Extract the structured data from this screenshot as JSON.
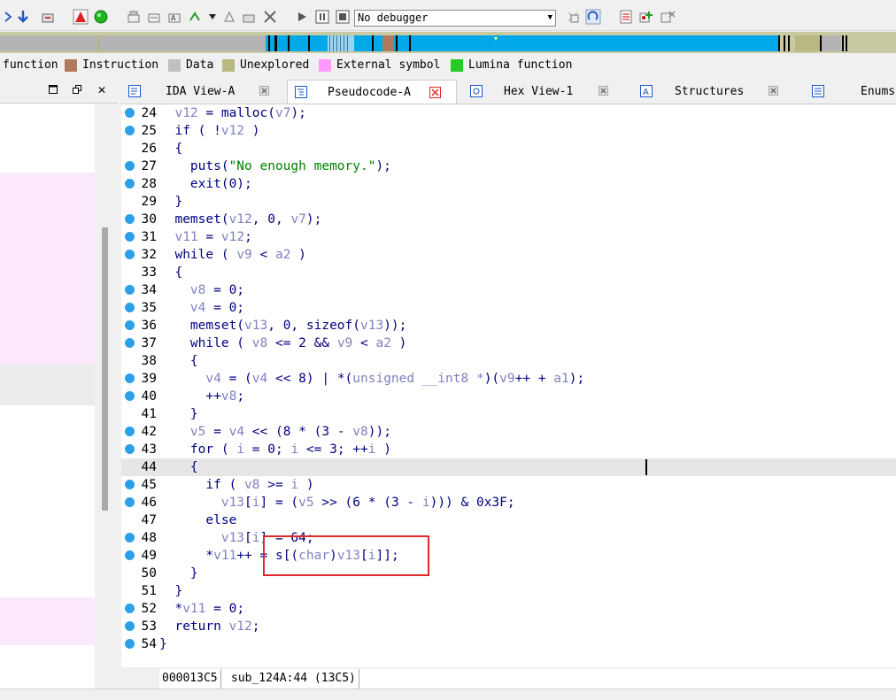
{
  "toolbar": {
    "debugger_select": "No debugger"
  },
  "legend": [
    {
      "label": "function",
      "color": "#00bbff"
    },
    {
      "label": "Instruction",
      "color": "#b07a5e"
    },
    {
      "label": "Data",
      "color": "#c0c0c0"
    },
    {
      "label": "Unexplored",
      "color": "#b8b880"
    },
    {
      "label": "External symbol",
      "color": "#ff99ff"
    },
    {
      "label": "Lumina function",
      "color": "#22cc22"
    }
  ],
  "tabs": [
    {
      "label": "IDA View-A",
      "icon": "ida-view-icon"
    },
    {
      "label": "Pseudocode-A",
      "icon": "pseudocode-icon"
    },
    {
      "label": "Hex View-1",
      "icon": "hex-view-icon"
    },
    {
      "label": "Structures",
      "icon": "structures-icon"
    },
    {
      "label": "Enums",
      "icon": "enums-icon"
    }
  ],
  "colors": {
    "dot": "#2ba0e8",
    "keyword": "#000080",
    "variable": "#8080c0",
    "string": "#008000",
    "highlight_box": "#e02a2a"
  },
  "code": [
    {
      "n": "24",
      "dot": true,
      "tokens": [
        [
          "  ",
          ""
        ],
        [
          "v12",
          "var"
        ],
        [
          " = malloc(",
          ""
        ],
        [
          "v7",
          "var"
        ],
        [
          ");",
          ""
        ]
      ]
    },
    {
      "n": "25",
      "dot": true,
      "tokens": [
        [
          "  if ( !",
          ""
        ],
        [
          "v12",
          "var"
        ],
        [
          " )",
          ""
        ]
      ]
    },
    {
      "n": "26",
      "dot": false,
      "tokens": [
        [
          "  {",
          ""
        ]
      ]
    },
    {
      "n": "27",
      "dot": true,
      "tokens": [
        [
          "    puts(",
          ""
        ],
        [
          "\"No enough memory.\"",
          "str"
        ],
        [
          ");",
          ""
        ]
      ]
    },
    {
      "n": "28",
      "dot": true,
      "tokens": [
        [
          "    exit(0);",
          ""
        ]
      ]
    },
    {
      "n": "29",
      "dot": false,
      "tokens": [
        [
          "  }",
          ""
        ]
      ]
    },
    {
      "n": "30",
      "dot": true,
      "tokens": [
        [
          "  memset(",
          ""
        ],
        [
          "v12",
          "var"
        ],
        [
          ", 0, ",
          ""
        ],
        [
          "v7",
          "var"
        ],
        [
          ");",
          ""
        ]
      ]
    },
    {
      "n": "31",
      "dot": true,
      "tokens": [
        [
          "  ",
          ""
        ],
        [
          "v11",
          "var"
        ],
        [
          " = ",
          ""
        ],
        [
          "v12",
          "var"
        ],
        [
          ";",
          ""
        ]
      ]
    },
    {
      "n": "32",
      "dot": true,
      "tokens": [
        [
          "  while ( ",
          ""
        ],
        [
          "v9",
          "var"
        ],
        [
          " < ",
          ""
        ],
        [
          "a2",
          "var"
        ],
        [
          " )",
          ""
        ]
      ]
    },
    {
      "n": "33",
      "dot": false,
      "tokens": [
        [
          "  {",
          ""
        ]
      ]
    },
    {
      "n": "34",
      "dot": true,
      "tokens": [
        [
          "    ",
          ""
        ],
        [
          "v8",
          "var"
        ],
        [
          " = 0;",
          ""
        ]
      ]
    },
    {
      "n": "35",
      "dot": true,
      "tokens": [
        [
          "    ",
          ""
        ],
        [
          "v4",
          "var"
        ],
        [
          " = 0;",
          ""
        ]
      ]
    },
    {
      "n": "36",
      "dot": true,
      "tokens": [
        [
          "    memset(",
          ""
        ],
        [
          "v13",
          "var"
        ],
        [
          ", 0, sizeof(",
          ""
        ],
        [
          "v13",
          "var"
        ],
        [
          "));",
          ""
        ]
      ]
    },
    {
      "n": "37",
      "dot": true,
      "tokens": [
        [
          "    while ( ",
          ""
        ],
        [
          "v8",
          "var"
        ],
        [
          " <= 2 && ",
          ""
        ],
        [
          "v9",
          "var"
        ],
        [
          " < ",
          ""
        ],
        [
          "a2",
          "var"
        ],
        [
          " )",
          ""
        ]
      ]
    },
    {
      "n": "38",
      "dot": false,
      "tokens": [
        [
          "    {",
          ""
        ]
      ]
    },
    {
      "n": "39",
      "dot": true,
      "tokens": [
        [
          "      ",
          ""
        ],
        [
          "v4",
          "var"
        ],
        [
          " = (",
          ""
        ],
        [
          "v4",
          "var"
        ],
        [
          " << 8) | *(",
          ""
        ],
        [
          "unsigned __int8 *",
          "var"
        ],
        [
          ")(",
          ""
        ],
        [
          "v9",
          "var"
        ],
        [
          "++ + ",
          ""
        ],
        [
          "a1",
          "var"
        ],
        [
          ");",
          ""
        ]
      ]
    },
    {
      "n": "40",
      "dot": true,
      "tokens": [
        [
          "      ++",
          ""
        ],
        [
          "v8",
          "var"
        ],
        [
          ";",
          ""
        ]
      ]
    },
    {
      "n": "41",
      "dot": false,
      "tokens": [
        [
          "    }",
          ""
        ]
      ]
    },
    {
      "n": "42",
      "dot": true,
      "tokens": [
        [
          "    ",
          ""
        ],
        [
          "v5",
          "var"
        ],
        [
          " = ",
          ""
        ],
        [
          "v4",
          "var"
        ],
        [
          " << (8 * (3 - ",
          ""
        ],
        [
          "v8",
          "var"
        ],
        [
          "));",
          ""
        ]
      ]
    },
    {
      "n": "43",
      "dot": true,
      "tokens": [
        [
          "    for ( ",
          ""
        ],
        [
          "i",
          "var"
        ],
        [
          " = 0; ",
          ""
        ],
        [
          "i",
          "var"
        ],
        [
          " <= 3; ++",
          ""
        ],
        [
          "i",
          "var"
        ],
        [
          " )",
          ""
        ]
      ]
    },
    {
      "n": "44",
      "dot": false,
      "tokens": [
        [
          "    {",
          ""
        ]
      ],
      "current": true
    },
    {
      "n": "45",
      "dot": true,
      "tokens": [
        [
          "      if ( ",
          ""
        ],
        [
          "v8",
          "var"
        ],
        [
          " >= ",
          ""
        ],
        [
          "i",
          "var"
        ],
        [
          " )",
          ""
        ]
      ]
    },
    {
      "n": "46",
      "dot": true,
      "tokens": [
        [
          "        ",
          ""
        ],
        [
          "v13",
          "var"
        ],
        [
          "[",
          ""
        ],
        [
          "i",
          "var"
        ],
        [
          "] = (",
          ""
        ],
        [
          "v5",
          "var"
        ],
        [
          " >> (6 * (3 - ",
          ""
        ],
        [
          "i",
          "var"
        ],
        [
          "))) & 0x3F;",
          ""
        ]
      ]
    },
    {
      "n": "47",
      "dot": false,
      "tokens": [
        [
          "      else",
          ""
        ]
      ]
    },
    {
      "n": "48",
      "dot": true,
      "tokens": [
        [
          "        ",
          ""
        ],
        [
          "v13",
          "var"
        ],
        [
          "[",
          ""
        ],
        [
          "i",
          "var"
        ],
        [
          "] = 64;",
          ""
        ]
      ]
    },
    {
      "n": "49",
      "dot": true,
      "tokens": [
        [
          "      *",
          ""
        ],
        [
          "v11",
          "var"
        ],
        [
          "++ = s[(",
          ""
        ],
        [
          "char",
          "var"
        ],
        [
          ")",
          ""
        ],
        [
          "v13",
          "var"
        ],
        [
          "[",
          ""
        ],
        [
          "i",
          "var"
        ],
        [
          "]];",
          ""
        ]
      ]
    },
    {
      "n": "50",
      "dot": false,
      "tokens": [
        [
          "    }",
          ""
        ]
      ]
    },
    {
      "n": "51",
      "dot": false,
      "tokens": [
        [
          "  }",
          ""
        ]
      ]
    },
    {
      "n": "52",
      "dot": true,
      "tokens": [
        [
          "  *",
          ""
        ],
        [
          "v11",
          "var"
        ],
        [
          " = 0;",
          ""
        ]
      ]
    },
    {
      "n": "53",
      "dot": true,
      "tokens": [
        [
          "  return ",
          ""
        ],
        [
          "v12",
          "var"
        ],
        [
          ";",
          ""
        ]
      ]
    },
    {
      "n": "54",
      "dot": true,
      "tokens": [
        [
          "}",
          ""
        ]
      ]
    }
  ],
  "status": {
    "address": "000013C5",
    "location": "sub_124A:44 (13C5)"
  }
}
